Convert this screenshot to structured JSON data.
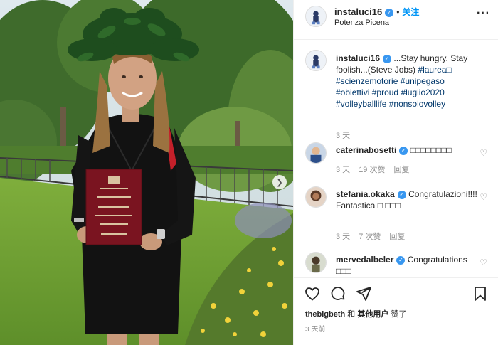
{
  "header": {
    "username": "instaluci16",
    "follow_label": "关注",
    "location": "Potenza Picena",
    "more_icon": "more-horizontal-icon"
  },
  "caption": {
    "username": "instaluci16",
    "text": "...Stay hungry. Stay foolish...(Steve Jobs)",
    "hashtags": [
      "#laurea□",
      "#scienzemotorie",
      "#unipegaso",
      "#obiettivi",
      "#proud",
      "#luglio2020",
      "#volleyballlife",
      "#nonsolovolley"
    ],
    "time": "3 天"
  },
  "comments": [
    {
      "username": "caterinabosetti",
      "text": "□□□□□□□□",
      "time": "3 天",
      "likes": "19 次赞",
      "reply": "回复"
    },
    {
      "username": "stefania.okaka",
      "text": "Congratulazioni!!!! Fantastica □ □□□",
      "time": "3 天",
      "likes": "7 次赞",
      "reply": "回复"
    },
    {
      "username": "mervedalbeler",
      "text": "Congratulations □□□",
      "time": "",
      "likes": "",
      "reply": ""
    }
  ],
  "actions": {
    "icons": [
      "heart-icon",
      "comment-icon",
      "share-icon",
      "bookmark-icon"
    ],
    "liked_by_prefix": "thebigbeth",
    "liked_by_and": "和",
    "liked_by_others": "其他用户",
    "liked_by_suffix": "赞了",
    "posted_time": "3 天前"
  },
  "photo": {
    "next_icon": "chevron-right-icon"
  },
  "colors": {
    "link": "#0095f6",
    "hashtag": "#00376b",
    "verified": "#3897f0",
    "muted": "#8e8e8e"
  }
}
